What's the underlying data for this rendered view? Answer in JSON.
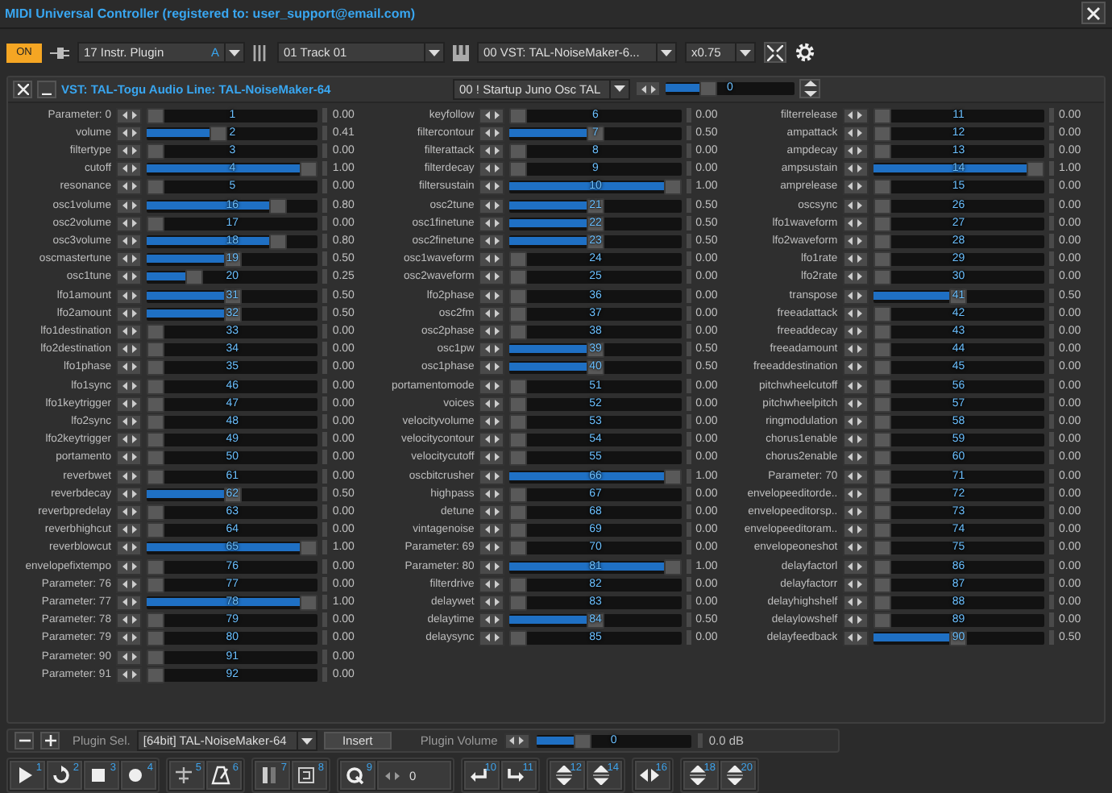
{
  "window": {
    "title": "MIDI Universal Controller  (registered to: user_support@email.com)"
  },
  "toolbar": {
    "power": {
      "label": "ON",
      "on": true
    },
    "plugin_type": {
      "value": "17 Instr. Plugin",
      "badge": "A"
    },
    "track": {
      "value": "01 Track 01"
    },
    "plugin": {
      "value": "00 VST: TAL-NoiseMaker-6..."
    },
    "zoom": {
      "value": "x0.75"
    }
  },
  "plugin_panel": {
    "title": "VST: TAL-Togu Audio Line: TAL-NoiseMaker-64",
    "preset": "00 ! Startup Juno Osc TAL",
    "program": {
      "level": 0.3,
      "value": "0"
    },
    "columns": [
      [
        [
          {
            "name": "Parameter: 0",
            "number": "1",
            "level": 0,
            "value": "0.00"
          },
          {
            "name": "volume",
            "number": "2",
            "level": 0.41,
            "value": "0.41"
          },
          {
            "name": "filtertype",
            "number": "3",
            "level": 0,
            "value": "0.00"
          },
          {
            "name": "cutoff",
            "number": "4",
            "level": 1,
            "value": "1.00"
          },
          {
            "name": "resonance",
            "number": "5",
            "level": 0,
            "value": "0.00"
          }
        ],
        [
          {
            "name": "osc1volume",
            "number": "16",
            "level": 0.8,
            "value": "0.80"
          },
          {
            "name": "osc2volume",
            "number": "17",
            "level": 0,
            "value": "0.00"
          },
          {
            "name": "osc3volume",
            "number": "18",
            "level": 0.8,
            "value": "0.80"
          },
          {
            "name": "oscmastertune",
            "number": "19",
            "level": 0.5,
            "value": "0.50"
          },
          {
            "name": "osc1tune",
            "number": "20",
            "level": 0.25,
            "value": "0.25"
          }
        ],
        [
          {
            "name": "lfo1amount",
            "number": "31",
            "level": 0.5,
            "value": "0.50"
          },
          {
            "name": "lfo2amount",
            "number": "32",
            "level": 0.5,
            "value": "0.50"
          },
          {
            "name": "lfo1destination",
            "number": "33",
            "level": 0,
            "value": "0.00"
          },
          {
            "name": "lfo2destination",
            "number": "34",
            "level": 0,
            "value": "0.00"
          },
          {
            "name": "lfo1phase",
            "number": "35",
            "level": 0,
            "value": "0.00"
          }
        ],
        [
          {
            "name": "lfo1sync",
            "number": "46",
            "level": 0,
            "value": "0.00"
          },
          {
            "name": "lfo1keytrigger",
            "number": "47",
            "level": 0,
            "value": "0.00"
          },
          {
            "name": "lfo2sync",
            "number": "48",
            "level": 0,
            "value": "0.00"
          },
          {
            "name": "lfo2keytrigger",
            "number": "49",
            "level": 0,
            "value": "0.00"
          },
          {
            "name": "portamento",
            "number": "50",
            "level": 0,
            "value": "0.00"
          }
        ],
        [
          {
            "name": "reverbwet",
            "number": "61",
            "level": 0,
            "value": "0.00"
          },
          {
            "name": "reverbdecay",
            "number": "62",
            "level": 0.5,
            "value": "0.50"
          },
          {
            "name": "reverbpredelay",
            "number": "63",
            "level": 0,
            "value": "0.00"
          },
          {
            "name": "reverbhighcut",
            "number": "64",
            "level": 0,
            "value": "0.00"
          },
          {
            "name": "reverblowcut",
            "number": "65",
            "level": 1,
            "value": "1.00"
          }
        ],
        [
          {
            "name": "envelopefixtempo",
            "number": "76",
            "level": 0,
            "value": "0.00"
          },
          {
            "name": "Parameter: 76",
            "number": "77",
            "level": 0,
            "value": "0.00"
          },
          {
            "name": "Parameter: 77",
            "number": "78",
            "level": 1,
            "value": "1.00"
          },
          {
            "name": "Parameter: 78",
            "number": "79",
            "level": 0,
            "value": "0.00"
          },
          {
            "name": "Parameter: 79",
            "number": "80",
            "level": 0,
            "value": "0.00"
          }
        ],
        [
          {
            "name": "Parameter: 90",
            "number": "91",
            "level": 0,
            "value": "0.00"
          },
          {
            "name": "Parameter: 91",
            "number": "92",
            "level": 0,
            "value": "0.00"
          }
        ]
      ],
      [
        [
          {
            "name": "keyfollow",
            "number": "6",
            "level": 0,
            "value": "0.00"
          },
          {
            "name": "filtercontour",
            "number": "7",
            "level": 0.5,
            "value": "0.50"
          },
          {
            "name": "filterattack",
            "number": "8",
            "level": 0,
            "value": "0.00"
          },
          {
            "name": "filterdecay",
            "number": "9",
            "level": 0,
            "value": "0.00"
          },
          {
            "name": "filtersustain",
            "number": "10",
            "level": 1,
            "value": "1.00"
          }
        ],
        [
          {
            "name": "osc2tune",
            "number": "21",
            "level": 0.5,
            "value": "0.50"
          },
          {
            "name": "osc1finetune",
            "number": "22",
            "level": 0.5,
            "value": "0.50"
          },
          {
            "name": "osc2finetune",
            "number": "23",
            "level": 0.5,
            "value": "0.50"
          },
          {
            "name": "osc1waveform",
            "number": "24",
            "level": 0,
            "value": "0.00"
          },
          {
            "name": "osc2waveform",
            "number": "25",
            "level": 0,
            "value": "0.00"
          }
        ],
        [
          {
            "name": "lfo2phase",
            "number": "36",
            "level": 0,
            "value": "0.00"
          },
          {
            "name": "osc2fm",
            "number": "37",
            "level": 0,
            "value": "0.00"
          },
          {
            "name": "osc2phase",
            "number": "38",
            "level": 0,
            "value": "0.00"
          },
          {
            "name": "osc1pw",
            "number": "39",
            "level": 0.5,
            "value": "0.50"
          },
          {
            "name": "osc1phase",
            "number": "40",
            "level": 0.5,
            "value": "0.50"
          }
        ],
        [
          {
            "name": "portamentomode",
            "number": "51",
            "level": 0,
            "value": "0.00"
          },
          {
            "name": "voices",
            "number": "52",
            "level": 0,
            "value": "0.00"
          },
          {
            "name": "velocityvolume",
            "number": "53",
            "level": 0,
            "value": "0.00"
          },
          {
            "name": "velocitycontour",
            "number": "54",
            "level": 0,
            "value": "0.00"
          },
          {
            "name": "velocitycutoff",
            "number": "55",
            "level": 0,
            "value": "0.00"
          }
        ],
        [
          {
            "name": "oscbitcrusher",
            "number": "66",
            "level": 1,
            "value": "1.00"
          },
          {
            "name": "highpass",
            "number": "67",
            "level": 0,
            "value": "0.00"
          },
          {
            "name": "detune",
            "number": "68",
            "level": 0,
            "value": "0.00"
          },
          {
            "name": "vintagenoise",
            "number": "69",
            "level": 0,
            "value": "0.00"
          },
          {
            "name": "Parameter: 69",
            "number": "70",
            "level": 0,
            "value": "0.00"
          }
        ],
        [
          {
            "name": "Parameter: 80",
            "number": "81",
            "level": 1,
            "value": "1.00"
          },
          {
            "name": "filterdrive",
            "number": "82",
            "level": 0,
            "value": "0.00"
          },
          {
            "name": "delaywet",
            "number": "83",
            "level": 0,
            "value": "0.00"
          },
          {
            "name": "delaytime",
            "number": "84",
            "level": 0.5,
            "value": "0.50"
          },
          {
            "name": "delaysync",
            "number": "85",
            "level": 0,
            "value": "0.00"
          }
        ]
      ],
      [
        [
          {
            "name": "filterrelease",
            "number": "11",
            "level": 0,
            "value": "0.00"
          },
          {
            "name": "ampattack",
            "number": "12",
            "level": 0,
            "value": "0.00"
          },
          {
            "name": "ampdecay",
            "number": "13",
            "level": 0,
            "value": "0.00"
          },
          {
            "name": "ampsustain",
            "number": "14",
            "level": 1,
            "value": "1.00"
          },
          {
            "name": "amprelease",
            "number": "15",
            "level": 0,
            "value": "0.00"
          }
        ],
        [
          {
            "name": "oscsync",
            "number": "26",
            "level": 0,
            "value": "0.00"
          },
          {
            "name": "lfo1waveform",
            "number": "27",
            "level": 0,
            "value": "0.00"
          },
          {
            "name": "lfo2waveform",
            "number": "28",
            "level": 0,
            "value": "0.00"
          },
          {
            "name": "lfo1rate",
            "number": "29",
            "level": 0,
            "value": "0.00"
          },
          {
            "name": "lfo2rate",
            "number": "30",
            "level": 0,
            "value": "0.00"
          }
        ],
        [
          {
            "name": "transpose",
            "number": "41",
            "level": 0.5,
            "value": "0.50"
          },
          {
            "name": "freeadattack",
            "number": "42",
            "level": 0,
            "value": "0.00"
          },
          {
            "name": "freeaddecay",
            "number": "43",
            "level": 0,
            "value": "0.00"
          },
          {
            "name": "freeadamount",
            "number": "44",
            "level": 0,
            "value": "0.00"
          },
          {
            "name": "freeaddestination",
            "number": "45",
            "level": 0,
            "value": "0.00"
          }
        ],
        [
          {
            "name": "pitchwheelcutoff",
            "number": "56",
            "level": 0,
            "value": "0.00"
          },
          {
            "name": "pitchwheelpitch",
            "number": "57",
            "level": 0,
            "value": "0.00"
          },
          {
            "name": "ringmodulation",
            "number": "58",
            "level": 0,
            "value": "0.00"
          },
          {
            "name": "chorus1enable",
            "number": "59",
            "level": 0,
            "value": "0.00"
          },
          {
            "name": "chorus2enable",
            "number": "60",
            "level": 0,
            "value": "0.00"
          }
        ],
        [
          {
            "name": "Parameter: 70",
            "number": "71",
            "level": 0,
            "value": "0.00"
          },
          {
            "name": "envelopeeditorde..",
            "number": "72",
            "level": 0,
            "value": "0.00"
          },
          {
            "name": "envelopeeditorsp..",
            "number": "73",
            "level": 0,
            "value": "0.00"
          },
          {
            "name": "envelopeeditoram..",
            "number": "74",
            "level": 0,
            "value": "0.00"
          },
          {
            "name": "envelopeoneshot",
            "number": "75",
            "level": 0,
            "value": "0.00"
          }
        ],
        [
          {
            "name": "delayfactorl",
            "number": "86",
            "level": 0,
            "value": "0.00"
          },
          {
            "name": "delayfactorr",
            "number": "87",
            "level": 0,
            "value": "0.00"
          },
          {
            "name": "delayhighshelf",
            "number": "88",
            "level": 0,
            "value": "0.00"
          },
          {
            "name": "delaylowshelf",
            "number": "89",
            "level": 0,
            "value": "0.00"
          },
          {
            "name": "delayfeedback",
            "number": "90",
            "level": 0.5,
            "value": "0.50"
          }
        ]
      ]
    ]
  },
  "plugin_bar": {
    "select_label": "Plugin Sel.",
    "select_value": "[64bit] TAL-NoiseMaker-64",
    "insert": "Insert",
    "volume_label": "Plugin Volume",
    "volume": {
      "level": 0.27,
      "value": "0"
    },
    "reading": "0.0 dB"
  },
  "transport": [
    [
      {
        "kind": "play",
        "number": "1"
      },
      {
        "kind": "loop",
        "number": "2"
      },
      {
        "kind": "stop",
        "number": "3"
      },
      {
        "kind": "record",
        "number": "4"
      }
    ],
    [
      {
        "kind": "cross",
        "number": "5"
      },
      {
        "kind": "metronome",
        "number": "6"
      }
    ],
    [
      {
        "kind": "bars",
        "number": "7"
      },
      {
        "kind": "frame",
        "number": "8"
      }
    ],
    [
      {
        "kind": "q",
        "number": "9"
      },
      {
        "kind": "field",
        "value": "0"
      }
    ],
    [
      {
        "kind": "undo",
        "number": "10"
      },
      {
        "kind": "redo",
        "number": "11"
      }
    ],
    [
      {
        "kind": "updown",
        "number": "12"
      },
      {
        "kind": "updown",
        "number": "14"
      }
    ],
    [
      {
        "kind": "leftright",
        "number": "16"
      }
    ],
    [
      {
        "kind": "updown",
        "number": "18"
      },
      {
        "kind": "updown",
        "number": "20"
      }
    ]
  ]
}
